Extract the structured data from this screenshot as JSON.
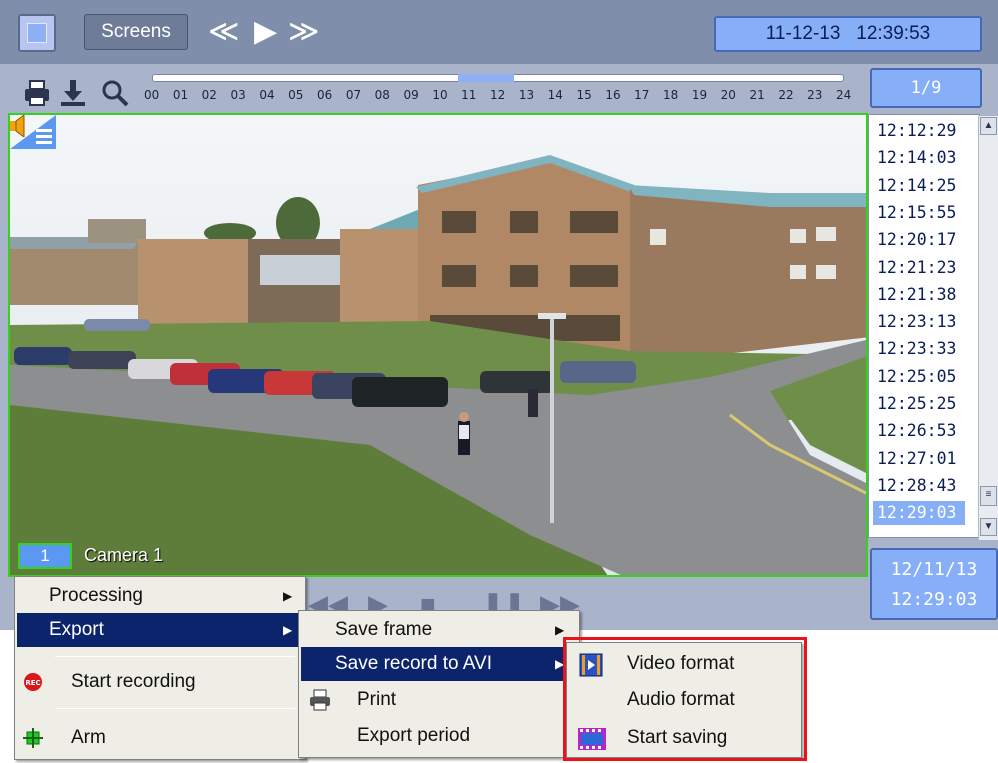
{
  "toolbar": {
    "screens_label": "Screens",
    "nav_prev": "≪",
    "nav_play": "▶",
    "nav_next": "≫",
    "clock": "11-12-13   12:39:53",
    "icons": [
      "print-icon",
      "download-icon",
      "search-icon"
    ]
  },
  "timeline": {
    "hours": [
      "00",
      "01",
      "02",
      "03",
      "04",
      "05",
      "06",
      "07",
      "08",
      "09",
      "10",
      "11",
      "12",
      "13",
      "14",
      "15",
      "16",
      "17",
      "18",
      "19",
      "20",
      "21",
      "22",
      "23",
      "24"
    ],
    "page_indicator": "1/9"
  },
  "camera": {
    "number": "1",
    "name": "Camera 1"
  },
  "time_list": {
    "items": [
      "12:12:29",
      "12:14:03",
      "12:14:25",
      "12:15:55",
      "12:20:17",
      "12:21:23",
      "12:21:38",
      "12:23:13",
      "12:23:33",
      "12:25:05",
      "12:25:25",
      "12:26:53",
      "12:27:01",
      "12:28:43",
      "12:29:03"
    ],
    "selected": "12:29:03"
  },
  "datebox": {
    "date": "12/11/13",
    "time": "12:29:03"
  },
  "context_menu": {
    "items": [
      {
        "label": "Processing",
        "submenu": true
      },
      {
        "label": "Export",
        "submenu": true,
        "highlighted": true
      },
      {
        "label": "Start recording",
        "icon": "rec-icon"
      },
      {
        "label": "Arm",
        "icon": "arm-icon"
      }
    ]
  },
  "export_submenu": {
    "items": [
      {
        "label": "Save frame",
        "submenu": true
      },
      {
        "label": "Save record to AVI",
        "submenu": true,
        "highlighted": true
      },
      {
        "label": "Print",
        "icon": "print-icon"
      },
      {
        "label": "Export period"
      }
    ]
  },
  "avi_submenu": {
    "items": [
      {
        "label": "Video format",
        "icon": "video-format-icon"
      },
      {
        "label": "Audio format"
      },
      {
        "label": "Start saving",
        "icon": "film-icon"
      }
    ]
  },
  "colors": {
    "accent_blue": "#86aff8",
    "selection_navy": "#0b246b",
    "camera_border": "#33d31a",
    "highlight_box": "#e8141c"
  }
}
